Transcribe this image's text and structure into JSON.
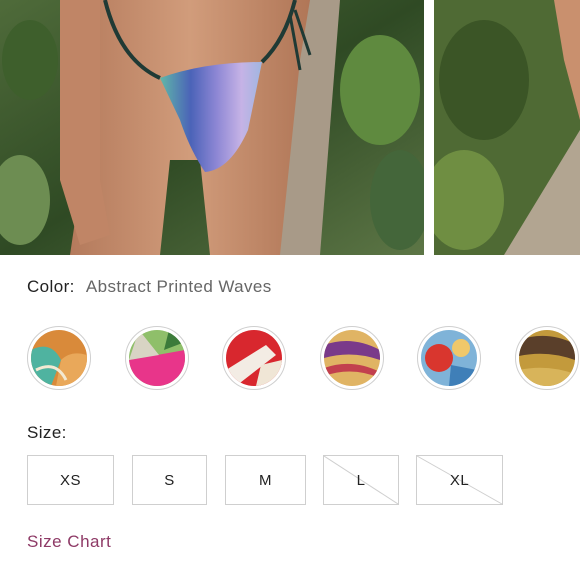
{
  "gallery": {
    "main_image": "model-swimwear-front-photo",
    "side_image": "model-swimwear-side-photo"
  },
  "color": {
    "label": "Color:",
    "selected_value": "Abstract Printed Waves",
    "swatches": [
      {
        "name": "abstract-printed-waves",
        "icon": "swatch-teal-orange"
      },
      {
        "name": "green-pink-print",
        "icon": "swatch-green-pink"
      },
      {
        "name": "red-white-print",
        "icon": "swatch-red-white"
      },
      {
        "name": "purple-gold-print",
        "icon": "swatch-purple-gold"
      },
      {
        "name": "floral-blue-red-print",
        "icon": "swatch-blue-red"
      },
      {
        "name": "brown-gold-print",
        "icon": "swatch-brown-gold"
      }
    ]
  },
  "size": {
    "label": "Size:",
    "options": [
      {
        "label": "XS",
        "available": true
      },
      {
        "label": "S",
        "available": true
      },
      {
        "label": "M",
        "available": true
      },
      {
        "label": "L",
        "available": false
      },
      {
        "label": "XL",
        "available": false
      }
    ]
  },
  "size_chart": {
    "label": "Size Chart"
  },
  "colors": {
    "accent_link": "#8e3a66",
    "border": "#cfcfcf",
    "muted_text": "#666666"
  }
}
